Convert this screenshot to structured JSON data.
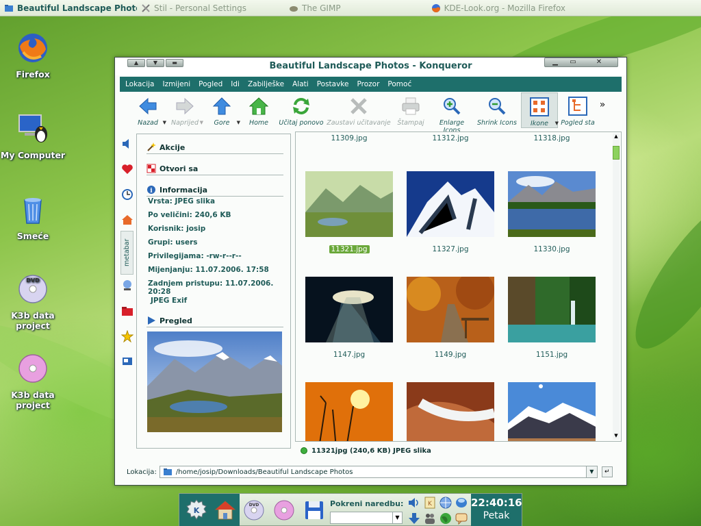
{
  "taskbar": {
    "tasks": [
      {
        "label": "Beautiful Landscape Photos - Konqueror",
        "active": true
      },
      {
        "label": "Stil - Personal Settings",
        "active": false
      },
      {
        "label": "The GIMP",
        "active": false
      },
      {
        "label": "KDE-Look.org - Mozilla Firefox",
        "active": false
      }
    ]
  },
  "desktop": {
    "icons": [
      {
        "label": "Firefox"
      },
      {
        "label": "My Computer"
      },
      {
        "label": "Smeće"
      },
      {
        "label": "K3b data project"
      },
      {
        "label": "K3b data project"
      }
    ]
  },
  "window": {
    "title": "Beautiful Landscape Photos - Konqueror",
    "menu": [
      "Lokacija",
      "Izmijeni",
      "Pogled",
      "Idi",
      "Zabilješke",
      "Alati",
      "Postavke",
      "Prozor",
      "Pomoć"
    ],
    "toolbar": [
      {
        "label": "Nazad",
        "icon": "back-arrow-icon",
        "enabled": true
      },
      {
        "label": "Naprijed",
        "icon": "forward-arrow-icon",
        "enabled": false
      },
      {
        "label": "Gore",
        "icon": "up-arrow-icon",
        "enabled": true
      },
      {
        "label": "Home",
        "icon": "home-icon",
        "enabled": true
      },
      {
        "label": "Učitaj ponovo",
        "icon": "reload-icon",
        "enabled": true
      },
      {
        "label": "Zaustavi učitavanje",
        "icon": "stop-icon",
        "enabled": false
      },
      {
        "label": "Štampaj",
        "icon": "print-icon",
        "enabled": false
      },
      {
        "label": "Enlarge Icons",
        "icon": "zoom-in-icon",
        "enabled": true
      },
      {
        "label": "Shrink Icons",
        "icon": "zoom-out-icon",
        "enabled": true
      },
      {
        "label": "Ikone",
        "icon": "icon-view-icon",
        "enabled": true
      },
      {
        "label": "Pogled sta",
        "icon": "tree-view-icon",
        "enabled": true
      }
    ],
    "toolbar_more": "»",
    "sidebar_tab": "metabar",
    "metabar": {
      "actions": "Akcije",
      "open_with": "Otvori sa",
      "info_title": "Informacija",
      "info": [
        "Vrsta: JPEG slika",
        "Po veličini: 240,6 KB",
        "Korisnik: josip",
        "Grupi: users",
        "Privilegijama: -rw-r--r--",
        "Mijenjanju: 11.07.2006. 17:58",
        "Zadnjem pristupu: 11.07.2006. 20:28"
      ],
      "exif": "JPEG Exif",
      "preview_title": "Pregled"
    },
    "files": {
      "top_row": [
        "11309.jpg",
        "11312.jpg",
        "11318.jpg"
      ],
      "rows": [
        [
          "11321.jpg",
          "11327.jpg",
          "11330.jpg"
        ],
        [
          "1147.jpg",
          "1149.jpg",
          "1151.jpg"
        ],
        [
          "",
          "",
          ""
        ]
      ],
      "selected": "11321.jpg"
    },
    "status": "11321jpg (240,6 KB)  JPEG slika",
    "location_label": "Lokacija:",
    "location_path": "/home/josip/Downloads/Beautiful Landscape Photos"
  },
  "panel": {
    "run_label": "Pokreni naredbu:",
    "clock_time": "22:40:16",
    "clock_day": "Petak"
  }
}
